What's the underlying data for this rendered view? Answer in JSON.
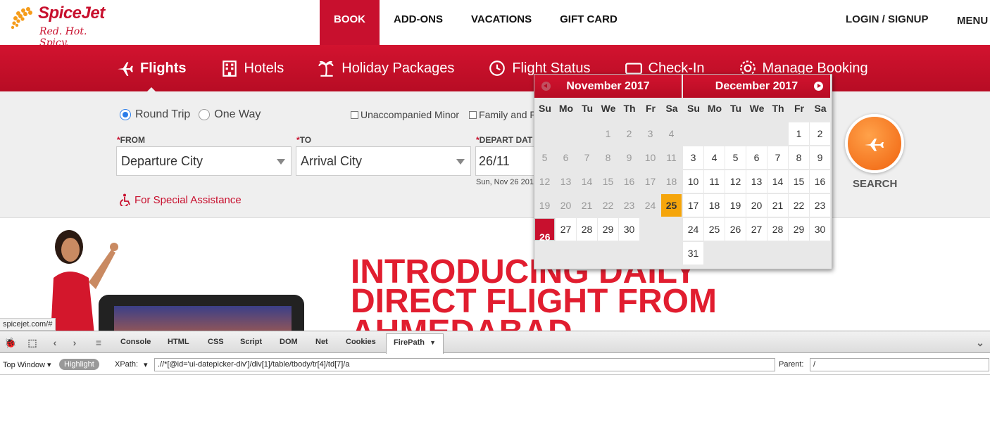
{
  "header": {
    "logo_name": "SpiceJet",
    "logo_tagline": "Red. Hot. Spicy.",
    "nav": [
      "BOOK",
      "ADD-ONS",
      "VACATIONS",
      "GIFT CARD"
    ],
    "login": "LOGIN / SIGNUP",
    "menu": "MENU"
  },
  "tabs": [
    "Flights",
    "Hotels",
    "Holiday Packages",
    "Flight Status",
    "Check-In",
    "Manage Booking"
  ],
  "search": {
    "round_trip": "Round Trip",
    "one_way": "One Way",
    "unaccompanied_minor": "Unaccompanied Minor",
    "family_friends": "Family and Fr",
    "from_label": "FROM",
    "to_label": "TO",
    "depart_label": "DEPART DAT",
    "from_value": "Departure City",
    "to_value": "Arrival City",
    "depart_value": "26/11",
    "depart_sub": "Sun, Nov 26 201",
    "assistance": "For Special Assistance",
    "search_button": "SEARCH"
  },
  "banner": {
    "line1": "INTRODUCING DAILY",
    "line2": "DIRECT FLIGHT FROM",
    "line3": "AHMEDABAD"
  },
  "status_url": "spicejet.com/#",
  "datepicker": {
    "dow": [
      "Su",
      "Mo",
      "Tu",
      "We",
      "Th",
      "Fr",
      "Sa"
    ],
    "months": [
      {
        "title": "November 2017",
        "rows": [
          [
            null,
            null,
            null,
            "1",
            "2",
            "3",
            "4"
          ],
          [
            "5",
            "6",
            "7",
            "8",
            "9",
            "10",
            "11"
          ],
          [
            "12",
            "13",
            "14",
            "15",
            "16",
            "17",
            "18"
          ],
          [
            "19",
            "20",
            "21",
            "22",
            "23",
            "24",
            "25"
          ],
          [
            "26",
            "27",
            "28",
            "29",
            "30",
            null,
            null
          ]
        ]
      },
      {
        "title": "December 2017",
        "rows": [
          [
            null,
            null,
            null,
            null,
            null,
            "1",
            "2"
          ],
          [
            "3",
            "4",
            "5",
            "6",
            "7",
            "8",
            "9"
          ],
          [
            "10",
            "11",
            "12",
            "13",
            "14",
            "15",
            "16"
          ],
          [
            "17",
            "18",
            "19",
            "20",
            "21",
            "22",
            "23"
          ],
          [
            "24",
            "25",
            "26",
            "27",
            "28",
            "29",
            "30"
          ],
          [
            "31",
            null,
            null,
            null,
            null,
            null,
            null
          ]
        ]
      }
    ],
    "today": "25",
    "selected": "26"
  },
  "firebug": {
    "tabs": [
      "Console",
      "HTML",
      "CSS",
      "Script",
      "DOM",
      "Net",
      "Cookies",
      "FirePath"
    ],
    "top_window": "Top Window",
    "highlight": "Highlight",
    "xpath_label": "XPath:",
    "xpath_value": ".//*[@id='ui-datepicker-div']/div[1]/table/tbody/tr[4]/td[7]/a",
    "parent_label": "Parent:",
    "parent_value": "/"
  },
  "colors": {
    "brand_red": "#c8102e",
    "accent_orange": "#f0620e",
    "today_yellow": "#f5a50b"
  }
}
